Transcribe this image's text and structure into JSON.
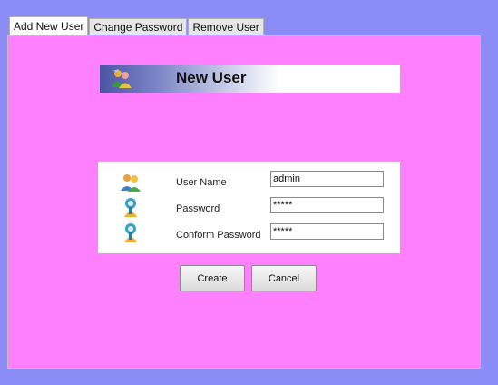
{
  "tabs": [
    {
      "label": "Add New User",
      "active": true
    },
    {
      "label": "Change Password",
      "active": false
    },
    {
      "label": "Remove User",
      "active": false
    }
  ],
  "header": {
    "title": "New User",
    "icon": "users-icon"
  },
  "form": {
    "user_name": {
      "label": "User Name",
      "value": "admin",
      "icon": "user-group-icon"
    },
    "password": {
      "label": "Password",
      "value": "*****",
      "icon": "key-user-icon"
    },
    "confirm_password": {
      "label": "Conform Password",
      "value": "*****",
      "icon": "key-user-icon"
    }
  },
  "buttons": {
    "create": "Create",
    "cancel": "Cancel"
  },
  "colors": {
    "background": "#8c8cf7",
    "panel": "#ff80ff",
    "header_gradient_start": "#4a54a3"
  }
}
